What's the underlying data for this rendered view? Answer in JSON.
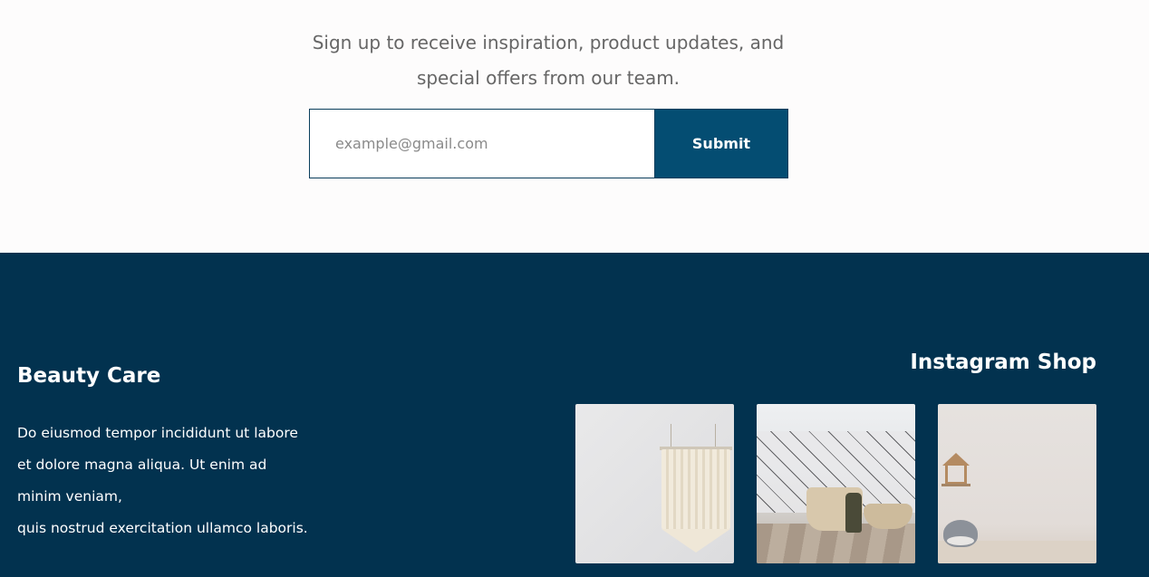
{
  "newsletter": {
    "tagline_line1": "Sign up to receive inspiration, product updates, and",
    "tagline_line2": "special offers from our team.",
    "email_placeholder": "example@gmail.com",
    "submit_label": "Submit"
  },
  "footer": {
    "brand": {
      "title": "Beauty Care",
      "description_lines": [
        "Do eiusmod tempor incididunt ut labore",
        "et dolore magna aliqua. Ut enim ad",
        "minim veniam,",
        "quis nostrud exercitation ullamco laboris."
      ]
    },
    "instagram": {
      "title": "Instagram Shop",
      "tiles": [
        "macrame-wall-hanging-photo",
        "bedroom-basket-photo",
        "nursery-shelf-whale-photo"
      ]
    }
  },
  "colors": {
    "accent": "#044d72",
    "footer_bg": "#02324f",
    "page_bg": "#fdfcfc"
  }
}
